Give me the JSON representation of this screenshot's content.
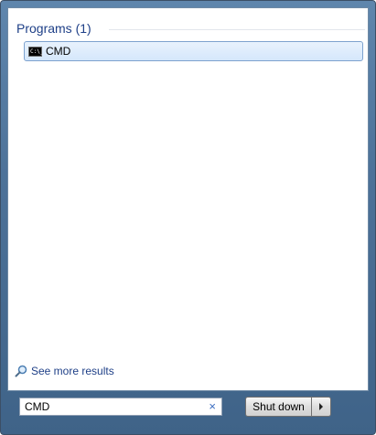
{
  "programs_section": {
    "header": "Programs (1)",
    "items": [
      {
        "label": "CMD",
        "icon_text": "C:\\_",
        "icon": "cmd-icon"
      }
    ]
  },
  "see_more": {
    "label": "See more results",
    "icon": "search-icon"
  },
  "search": {
    "value": "CMD",
    "clear_icon": "×"
  },
  "shutdown": {
    "label": "Shut down",
    "arrow_icon": "right-arrow-icon"
  },
  "colors": {
    "frame": "#4d7299",
    "header_text": "#1e3f87",
    "selection_border": "#7da2ce",
    "selection_fill": "#d5e7fb"
  }
}
